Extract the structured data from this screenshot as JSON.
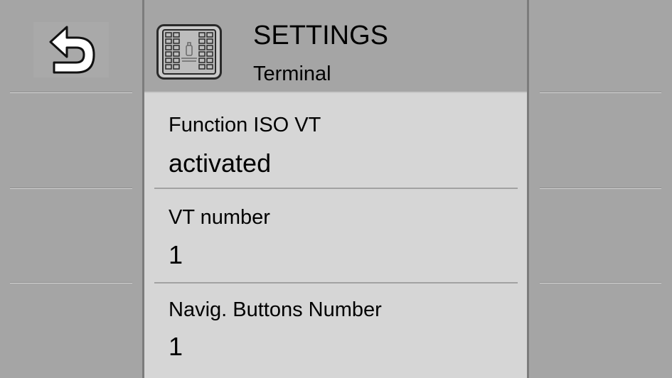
{
  "header": {
    "title": "SETTINGS",
    "subtitle": "Terminal",
    "icon": "terminal-screen-icon"
  },
  "nav": {
    "back_icon": "back-arrow-icon"
  },
  "settings": [
    {
      "label": "Function ISO VT",
      "value": "activated"
    },
    {
      "label": "VT number",
      "value": "1"
    },
    {
      "label": "Navig. Buttons Number",
      "value": "1"
    }
  ],
  "colors": {
    "background": "#a5a5a5",
    "list_background": "#d6d6d6",
    "text": "#000000"
  }
}
